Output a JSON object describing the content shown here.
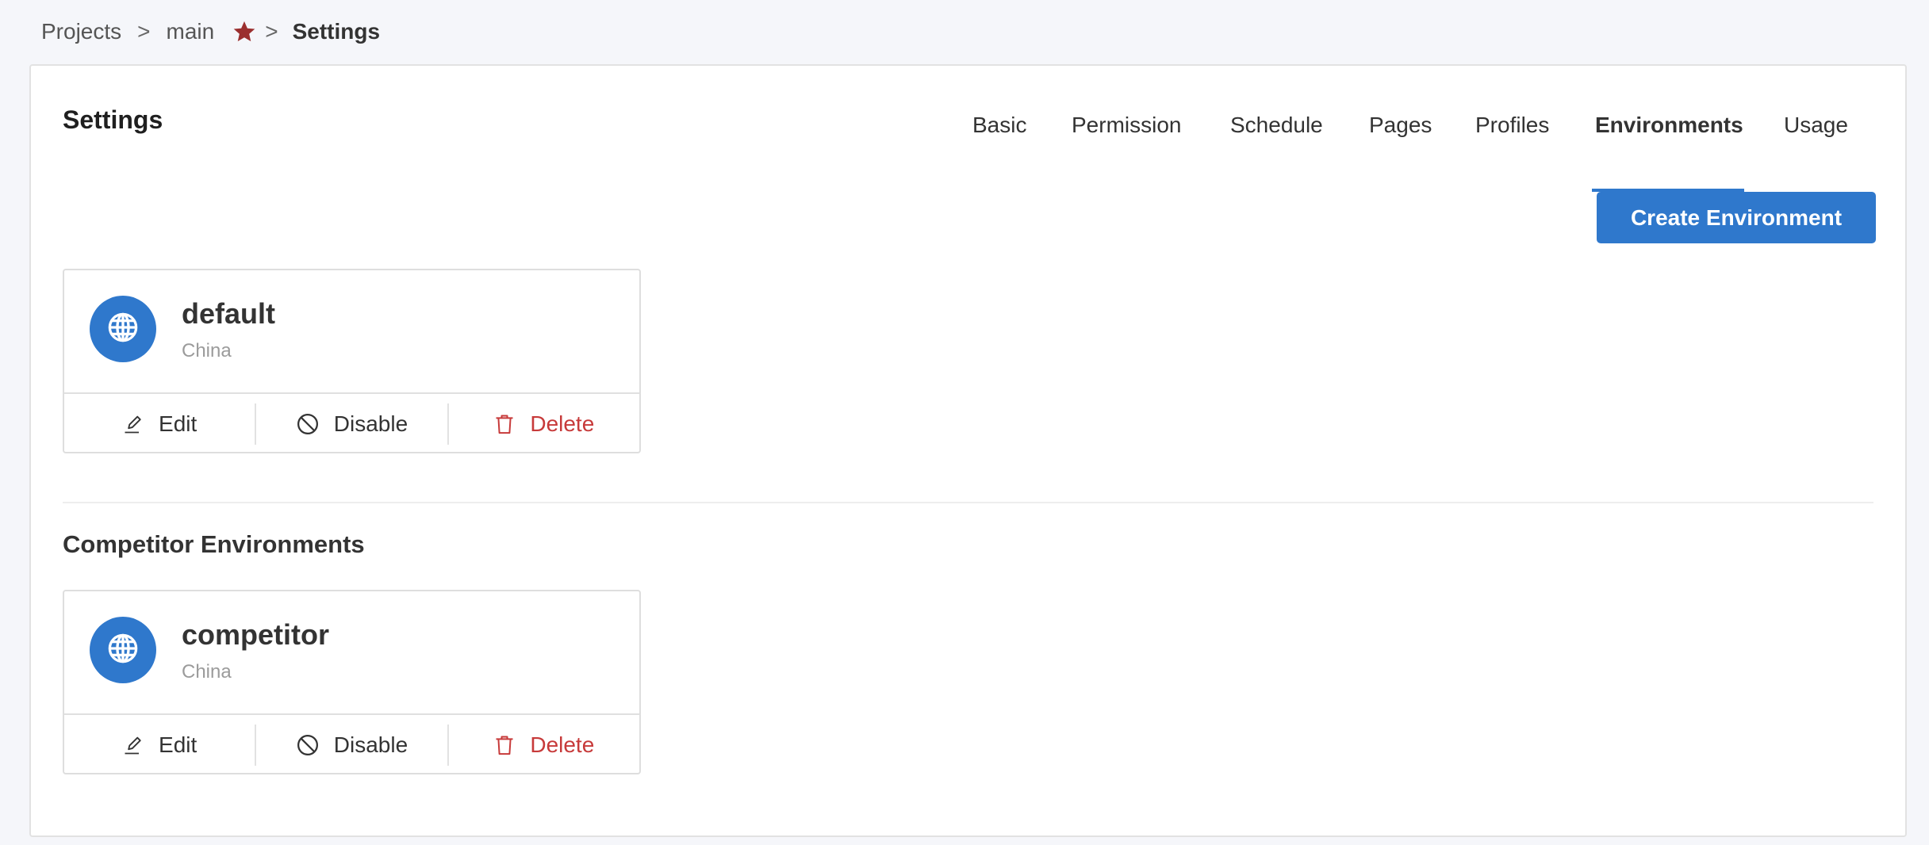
{
  "breadcrumb": {
    "items": [
      "Projects",
      "main",
      "Settings"
    ],
    "separator": ">",
    "favorite_icon": "star-icon",
    "favorite_color": "#9b2f2f"
  },
  "page": {
    "title": "Settings"
  },
  "tabs": [
    {
      "label": "Basic",
      "active": false
    },
    {
      "label": "Permission",
      "active": false
    },
    {
      "label": "Schedule",
      "active": false
    },
    {
      "label": "Pages",
      "active": false
    },
    {
      "label": "Profiles",
      "active": false
    },
    {
      "label": "Environments",
      "active": true
    },
    {
      "label": "Usage",
      "active": false
    }
  ],
  "toolbar": {
    "create_label": "Create Environment"
  },
  "environments": [
    {
      "name": "default",
      "region": "China",
      "icon": "globe-icon",
      "actions": {
        "edit": "Edit",
        "disable": "Disable",
        "delete": "Delete"
      }
    }
  ],
  "competitor_section": {
    "title": "Competitor Environments",
    "environments": [
      {
        "name": "competitor",
        "region": "China",
        "icon": "globe-icon",
        "actions": {
          "edit": "Edit",
          "disable": "Disable",
          "delete": "Delete"
        }
      }
    ]
  },
  "colors": {
    "accent": "#2f78cc",
    "danger": "#c73a3a",
    "background": "#f5f6fa",
    "favorite": "#9b2f2f"
  }
}
